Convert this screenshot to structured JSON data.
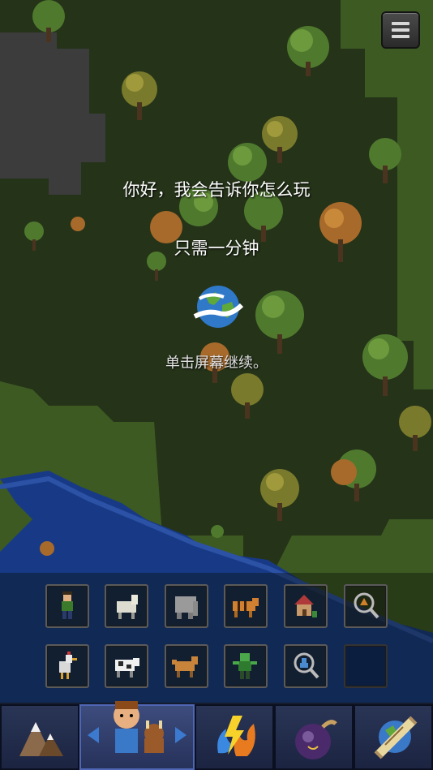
{
  "tutorial": {
    "line1": "你好，我会告诉你怎么玩",
    "line2": "只需一分钟",
    "hint": "单击屏幕继续。"
  },
  "toolbar": {
    "row1": [
      {
        "name": "human",
        "icon": "human-icon"
      },
      {
        "name": "sheep",
        "icon": "sheep-icon"
      },
      {
        "name": "elephant",
        "icon": "elephant-icon"
      },
      {
        "name": "tiger",
        "icon": "tiger-icon"
      },
      {
        "name": "house",
        "icon": "house-icon"
      },
      {
        "name": "inspect-village",
        "icon": "village-magnifier-icon"
      }
    ],
    "row2": [
      {
        "name": "chicken",
        "icon": "chicken-icon"
      },
      {
        "name": "cow",
        "icon": "cow-icon"
      },
      {
        "name": "fox",
        "icon": "fox-icon"
      },
      {
        "name": "zombie",
        "icon": "zombie-icon"
      },
      {
        "name": "inspect-unit",
        "icon": "unit-magnifier-icon"
      },
      {
        "name": "empty",
        "icon": ""
      }
    ]
  },
  "bottom_tabs": [
    {
      "name": "terrain",
      "icon": "mountain-icon"
    },
    {
      "name": "creatures",
      "icon": "creatures-icon",
      "active": true
    },
    {
      "name": "powers",
      "icon": "lightning-fire-icon"
    },
    {
      "name": "bombs",
      "icon": "bomb-icon"
    },
    {
      "name": "world",
      "icon": "scroll-globe-icon"
    }
  ],
  "colors": {
    "grass_dark": "#253319",
    "grass_light": "#3d5a22",
    "rock": "#3c3c3c",
    "water": "#183a86",
    "bar_bg": "#1b2441",
    "active_tab": "#3d4c7e"
  }
}
